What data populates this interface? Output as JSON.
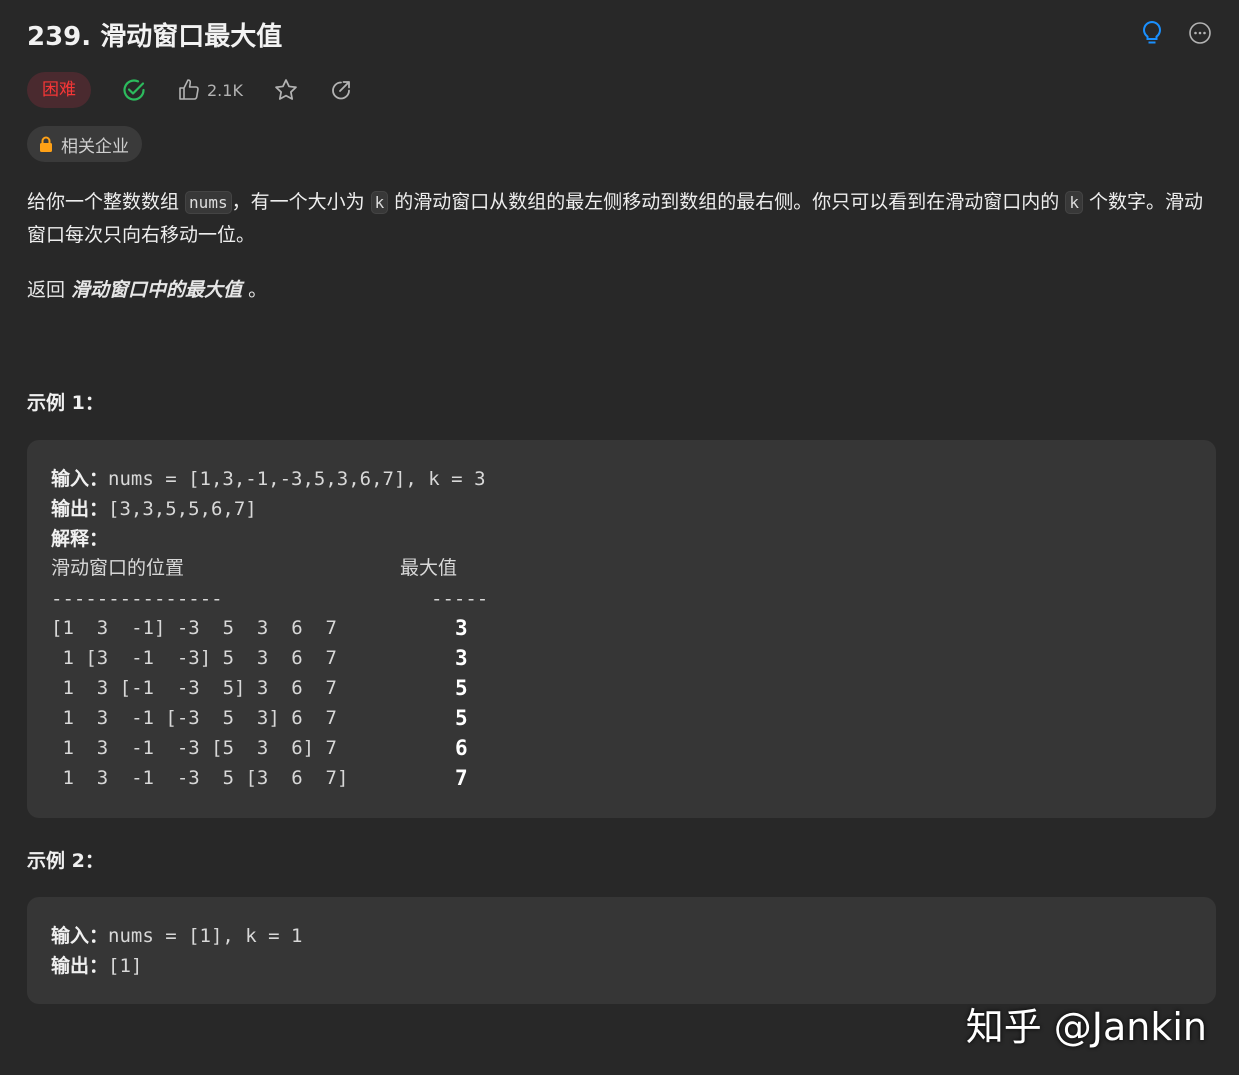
{
  "header": {
    "title": "239. 滑动窗口最大值"
  },
  "meta": {
    "difficulty": "困难",
    "likes": "2.1K",
    "company_tag": "相关企业"
  },
  "description": {
    "p1_a": "给你一个整数数组 ",
    "code_nums": "nums",
    "p1_b": "，有一个大小为 ",
    "code_k": "k",
    "p1_c": " 的滑动窗口从数组的最左侧移动到数组的最右侧。你只可以看到在滑动窗口内的 ",
    "code_k2": "k",
    "p1_d": " 个数字。滑动窗口每次只向右移动一位。",
    "return_prefix": "返回 ",
    "return_italic": "滑动窗口中的最大值",
    "return_suffix": " 。"
  },
  "example1": {
    "title": "示例 1：",
    "input_label": "输入：",
    "input_value": "nums = [1,3,-1,-3,5,3,6,7], k = 3",
    "output_label": "输出：",
    "output_value": "[3,3,5,5,6,7]",
    "explain_label": "解释：",
    "col1_header": "滑动窗口的位置",
    "col2_header": "最大值",
    "sep1": "---------------",
    "sep2": "-----",
    "rows": [
      {
        "window": "[1  3  -1] -3  5  3  6  7",
        "max": "3"
      },
      {
        "window": " 1 [3  -1  -3] 5  3  6  7",
        "max": "3"
      },
      {
        "window": " 1  3 [-1  -3  5] 3  6  7",
        "max": "5"
      },
      {
        "window": " 1  3  -1 [-3  5  3] 6  7",
        "max": "5"
      },
      {
        "window": " 1  3  -1  -3 [5  3  6] 7",
        "max": "6"
      },
      {
        "window": " 1  3  -1  -3  5 [3  6  7]",
        "max": "7"
      }
    ]
  },
  "example2": {
    "title": "示例 2：",
    "input_label": "输入：",
    "input_value": "nums = [1], k = 1",
    "output_label": "输出：",
    "output_value": "[1]"
  },
  "watermark": "知乎 @Jankin",
  "colors": {
    "background": "#282828",
    "hard_badge_text": "#f63636",
    "accepted_green": "#2cbb5d",
    "hint_blue": "#1a90ff",
    "lock_orange": "#ffa116"
  }
}
